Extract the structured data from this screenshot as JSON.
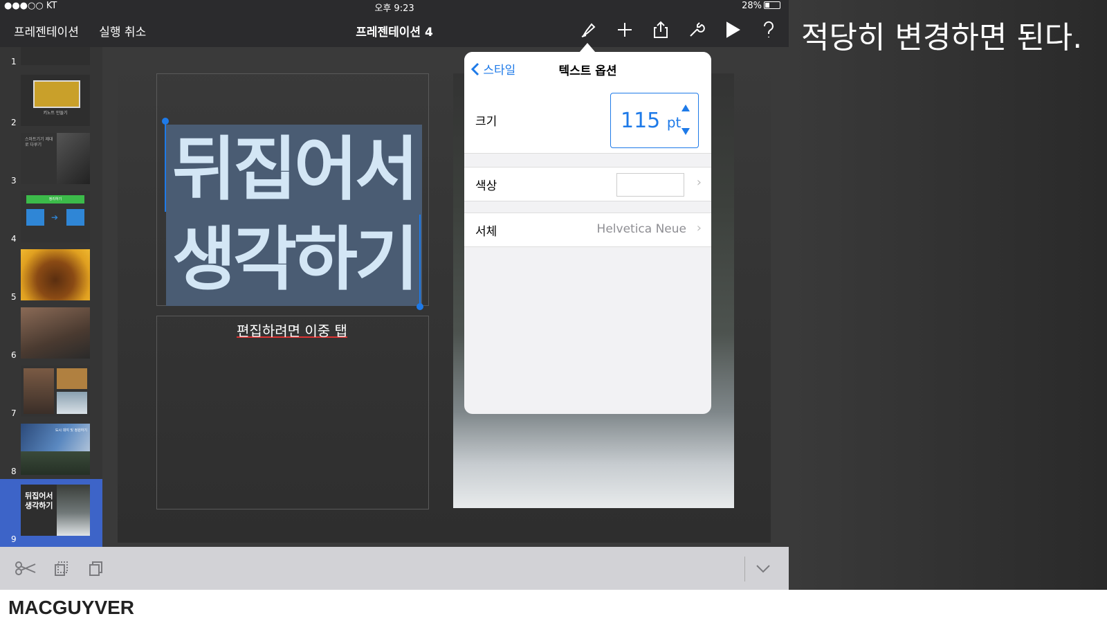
{
  "status": {
    "carrier": "●●●○○ KT",
    "time": "오후 9:23",
    "battery": "28%"
  },
  "toolbar": {
    "presentations": "프레젠테이션",
    "undo": "실행 취소",
    "title": "프레젠테이션 4"
  },
  "slides": [
    {
      "num": "1"
    },
    {
      "num": "2",
      "caption": "키노트 만들기"
    },
    {
      "num": "3",
      "caption": "스마트기기 제대로 다루기"
    },
    {
      "num": "4",
      "caption": "정리하기"
    },
    {
      "num": "5"
    },
    {
      "num": "6"
    },
    {
      "num": "7"
    },
    {
      "num": "8",
      "caption": "도시 대지 및 정원하기"
    },
    {
      "num": "9",
      "caption": "뒤집어서 생각하기",
      "selected": true
    }
  ],
  "slide": {
    "title_line1": "뒤집어서",
    "title_line2": "생각하기",
    "subtitle": "편집하려면 이중 탭"
  },
  "popover": {
    "back": "스타일",
    "title": "텍스트 옵션",
    "size_label": "크기",
    "size_value": "115",
    "size_unit": "pt",
    "color_label": "색상",
    "font_label": "서체",
    "font_value": "Helvetica Neue"
  },
  "caption": "적당히 변경하면 된다.",
  "brand": "MACGUYVER",
  "colors": {
    "accent": "#1e7ae8",
    "selection": "#3d64c8"
  }
}
